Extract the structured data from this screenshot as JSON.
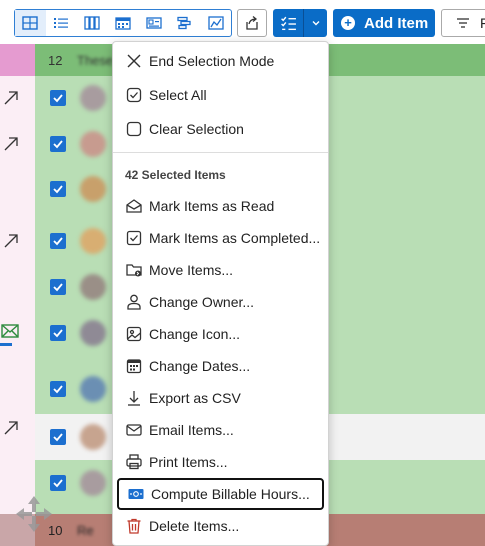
{
  "toolbar": {
    "view_buttons": [
      "grid-view-icon",
      "list-view-icon",
      "columns-view-icon",
      "calendar-view-icon",
      "card-view-icon",
      "gantt-view-icon",
      "chart-view-icon"
    ],
    "add_item_label": "Add Item",
    "filter_label": "F"
  },
  "list": {
    "group_count": "12",
    "group_label": "These",
    "footer_group_count": "10",
    "footer_group_label": "Re"
  },
  "menu": {
    "end_selection": "End Selection Mode",
    "select_all": "Select All",
    "clear_selection": "Clear Selection",
    "section_header": "42 Selected Items",
    "items": [
      {
        "label": "Mark Items as Read",
        "icon": "envelope-open-icon"
      },
      {
        "label": "Mark Items as Completed...",
        "icon": "checkbox-icon"
      },
      {
        "label": "Move Items...",
        "icon": "folder-move-icon"
      },
      {
        "label": "Change Owner...",
        "icon": "person-icon"
      },
      {
        "label": "Change Icon...",
        "icon": "image-icon"
      },
      {
        "label": "Change Dates...",
        "icon": "calendar-icon"
      },
      {
        "label": "Export as CSV",
        "icon": "download-icon"
      },
      {
        "label": "Email Items...",
        "icon": "envelope-icon"
      },
      {
        "label": "Print Items...",
        "icon": "printer-icon"
      },
      {
        "label": "Compute Billable Hours...",
        "icon": "money-icon"
      },
      {
        "label": "Delete Items...",
        "icon": "trash-icon"
      }
    ]
  },
  "colors": {
    "accent": "#0a6cc7",
    "group_green": "#7cbd77",
    "row_green": "#b9deb5",
    "delete_red": "#c0392b"
  }
}
